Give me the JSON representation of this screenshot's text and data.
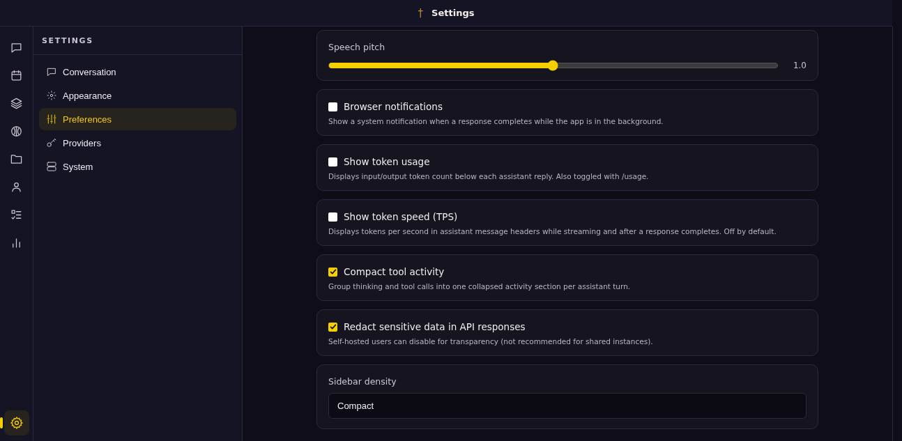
{
  "header": {
    "logo": "†",
    "title": "Settings"
  },
  "rail": [
    {
      "selected": false
    },
    {
      "selected": false
    },
    {
      "selected": false
    },
    {
      "selected": false
    },
    {
      "selected": false
    },
    {
      "selected": false
    },
    {
      "selected": false
    },
    {
      "selected": false
    }
  ],
  "rail_bottom": {
    "selected": true
  },
  "sidebar": {
    "heading": "SETTINGS",
    "items": [
      {
        "label": "Conversation",
        "selected": false
      },
      {
        "label": "Appearance",
        "selected": false
      },
      {
        "label": "Preferences",
        "selected": true
      },
      {
        "label": "Providers",
        "selected": false
      },
      {
        "label": "System",
        "selected": false
      }
    ]
  },
  "settings": [
    {
      "kind": "slider",
      "label": "Speech pitch",
      "level": 0.5,
      "reading": "1.0"
    },
    {
      "kind": "checkbox",
      "label": "Browser notifications",
      "checked": false,
      "description": "Show a system notification when a response completes while the app is in the background."
    },
    {
      "kind": "checkbox",
      "label": "Show token usage",
      "checked": false,
      "description": "Displays input/output token count below each assistant reply. Also toggled with /usage."
    },
    {
      "kind": "checkbox",
      "label": "Show token speed (TPS)",
      "checked": false,
      "description": "Displays tokens per second in assistant message headers while streaming and after a response completes. Off by default."
    },
    {
      "kind": "checkbox",
      "label": "Compact tool activity",
      "checked": true,
      "description": "Group thinking and tool calls into one collapsed activity section per assistant turn."
    },
    {
      "kind": "checkbox",
      "label": "Redact sensitive data in API responses",
      "checked": true,
      "description": "Self-hosted users can disable for transparency (not recommended for shared instances)."
    },
    {
      "kind": "select",
      "label": "Sidebar density",
      "value": "Compact"
    }
  ]
}
